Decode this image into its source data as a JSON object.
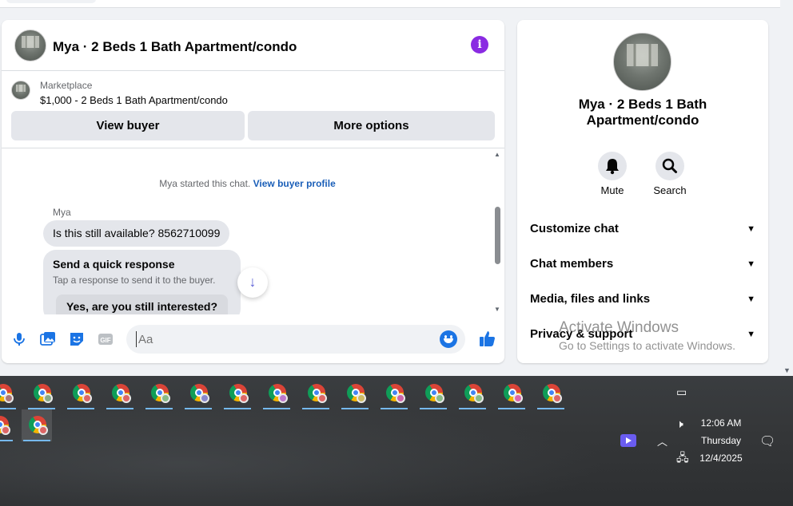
{
  "chat": {
    "title": "Mya · 2 Beds 1 Bath Apartment/condo",
    "info_icon": "info-icon",
    "marketplace_label": "Marketplace",
    "listing": "$1,000 - 2 Beds 1 Bath Apartment/condo",
    "view_buyer": "View buyer",
    "more_options": "More options",
    "system_text": "Mya started this chat.",
    "system_link": "View buyer profile",
    "sender": "Mya",
    "message": "Is this still available? 8562710099",
    "quick_title": "Send a quick response",
    "quick_sub": "Tap a response to send it to the buyer.",
    "quick_reply": "Yes, are you still interested?",
    "composer_placeholder": "Aa"
  },
  "info": {
    "name": "Mya · 2 Beds 1 Bath Apartment/condo",
    "actions": [
      {
        "label": "Mute",
        "icon": "bell-icon"
      },
      {
        "label": "Search",
        "icon": "search-icon"
      }
    ],
    "sections": [
      "Customize chat",
      "Chat members",
      "Media, files and links",
      "Privacy & support"
    ]
  },
  "watermark": {
    "line1": "Activate Windows",
    "line2": "Go to Settings to activate Windows."
  },
  "taskbar": {
    "time": "12:06 AM",
    "day": "Thursday",
    "date": "12/4/2025"
  },
  "colors": {
    "accent": "#8a2be2",
    "messenger_blue": "#1b74e4",
    "taskbar": "#353739"
  }
}
